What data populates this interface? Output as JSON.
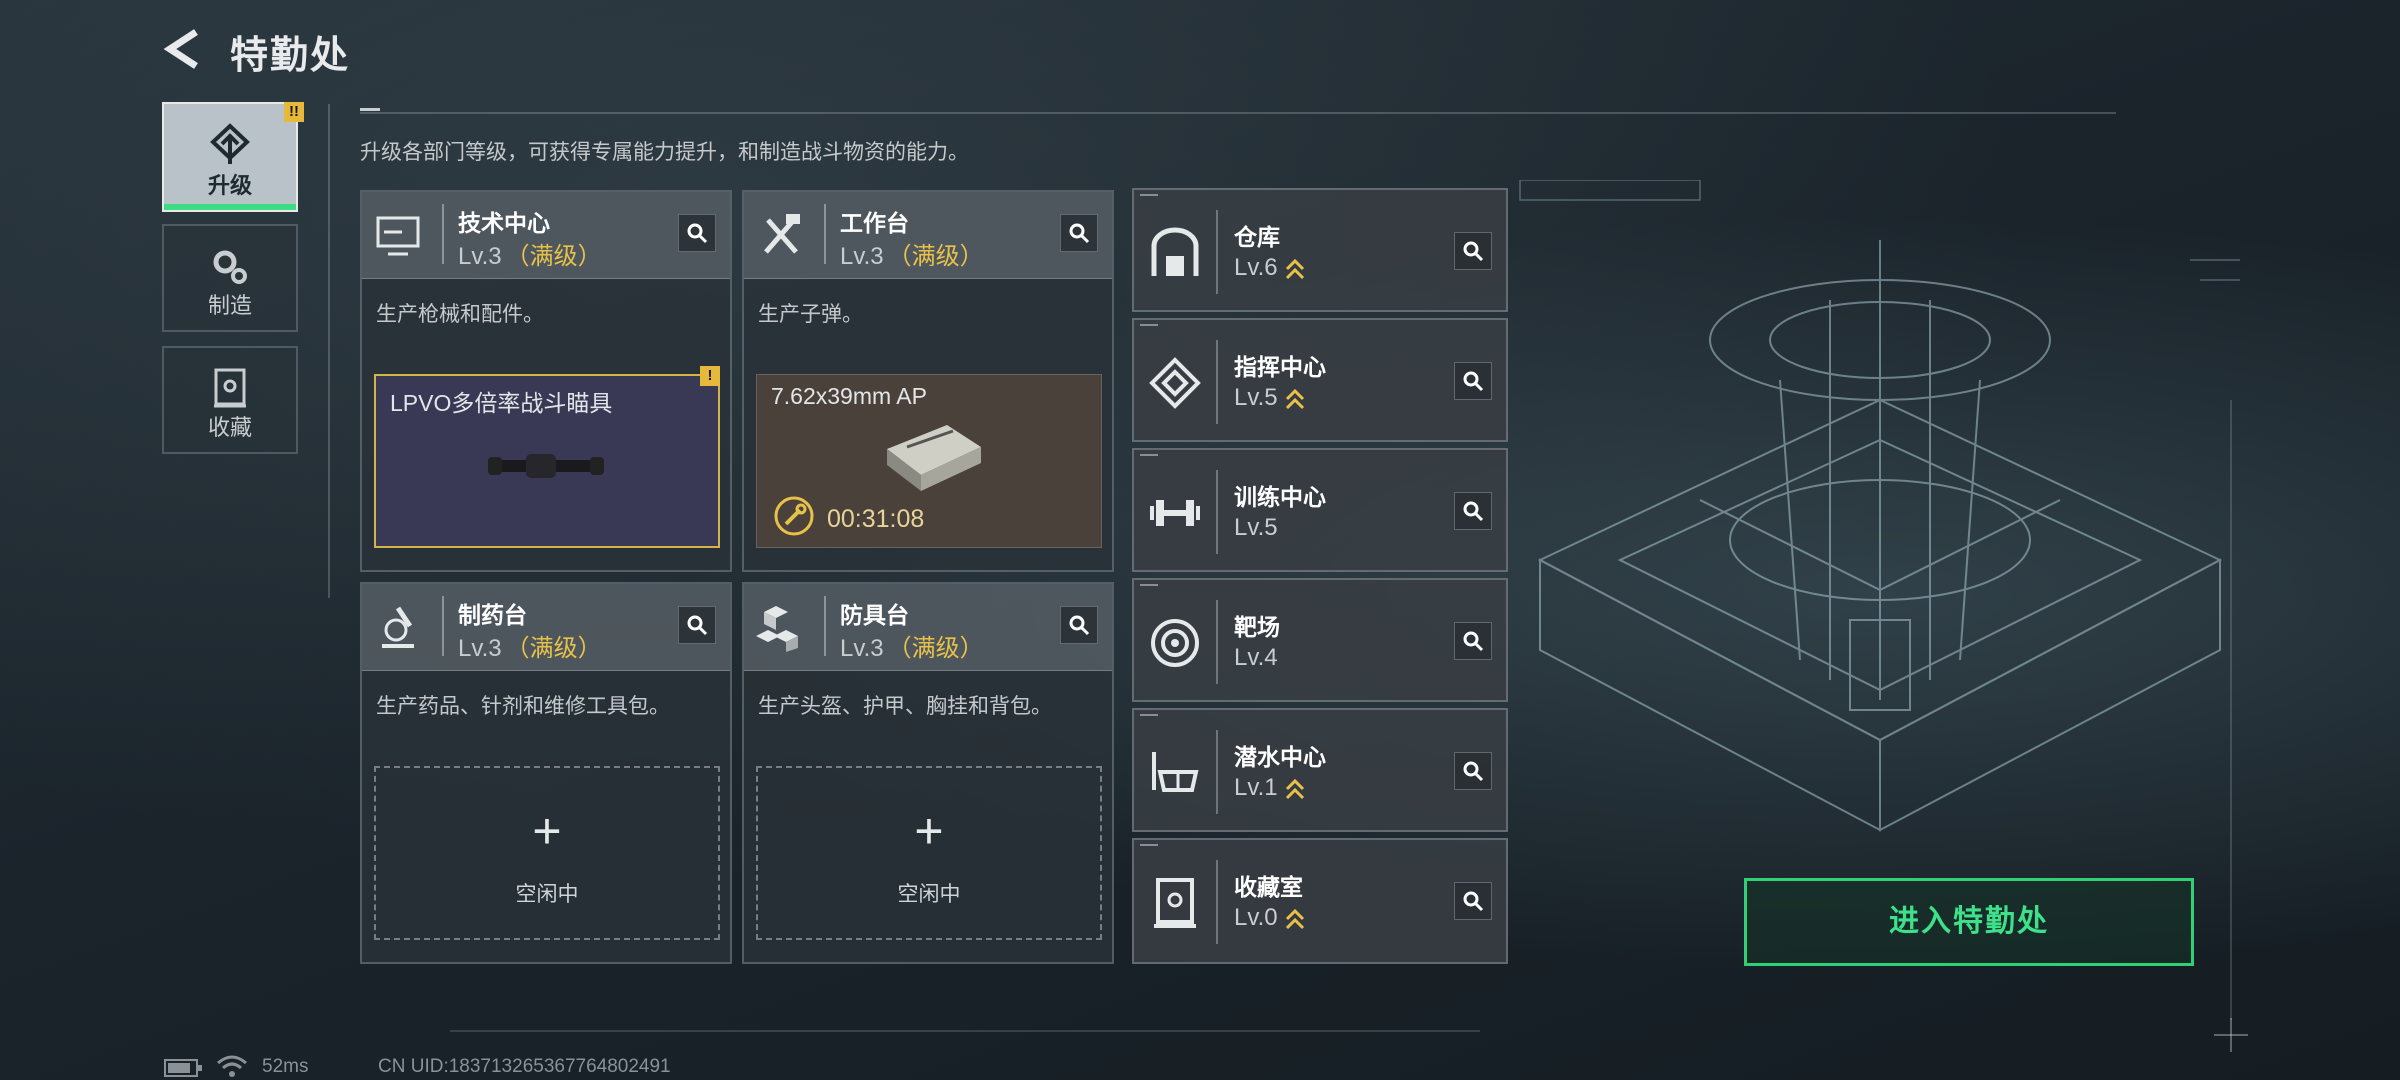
{
  "header": {
    "title": "特勤处"
  },
  "nav": [
    {
      "label": "升级",
      "active": true,
      "badge": "!!"
    },
    {
      "label": "制造",
      "active": false
    },
    {
      "label": "收藏",
      "active": false
    }
  ],
  "description": "升级各部门等级，可获得专属能力提升，和制造战斗物资的能力。",
  "workstations": [
    {
      "name": "技术中心",
      "level": "Lv.3",
      "status": "（满级）",
      "desc": "生产枪械和配件。",
      "slot": {
        "item": "LPVO多倍率战斗瞄具",
        "badge": "!"
      }
    },
    {
      "name": "工作台",
      "level": "Lv.3",
      "status": "（满级）",
      "desc": "生产子弹。",
      "slot": {
        "item": "7.62x39mm AP",
        "timer": "00:31:08"
      }
    },
    {
      "name": "制药台",
      "level": "Lv.3",
      "status": "（满级）",
      "desc": "生产药品、针剂和维修工具包。",
      "slot": {
        "plus": "+",
        "text": "空闲中"
      }
    },
    {
      "name": "防具台",
      "level": "Lv.3",
      "status": "（满级）",
      "desc": "生产头盔、护甲、胸挂和背包。",
      "slot": {
        "plus": "+",
        "text": "空闲中"
      }
    }
  ],
  "departments": [
    {
      "name": "仓库",
      "level": "Lv.6",
      "upgradable": true,
      "icon": "warehouse-icon"
    },
    {
      "name": "指挥中心",
      "level": "Lv.5",
      "upgradable": true,
      "icon": "command-center-icon"
    },
    {
      "name": "训练中心",
      "level": "Lv.5",
      "upgradable": false,
      "icon": "dumbbell-icon"
    },
    {
      "name": "靶场",
      "level": "Lv.4",
      "upgradable": false,
      "icon": "target-icon"
    },
    {
      "name": "潜水中心",
      "level": "Lv.1",
      "upgradable": true,
      "icon": "diving-mask-icon"
    },
    {
      "name": "收藏室",
      "level": "Lv.0",
      "upgradable": true,
      "icon": "collection-room-icon"
    }
  ],
  "enter_button": "进入特勤处",
  "footer": {
    "latency": "52ms",
    "uid": "CN UID:1837132653677648024​91"
  },
  "colors": {
    "accent_green": "#3ddc84",
    "gold": "#e8c14b",
    "warning": "#e7b93b"
  }
}
